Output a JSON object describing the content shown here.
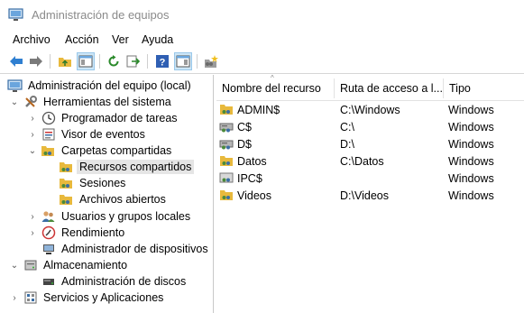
{
  "window": {
    "title": "Administración de equipos"
  },
  "menu": [
    "Archivo",
    "Acción",
    "Ver",
    "Ayuda"
  ],
  "toolbar": {
    "buttons": [
      "back-icon",
      "forward-icon",
      "up-folder-icon",
      "show-hide-tree-icon",
      "refresh-icon",
      "export-list-icon",
      "help-icon",
      "show-action-pane-icon",
      "new-share-icon"
    ]
  },
  "tree": {
    "root": "Administración del equipo (local)",
    "system_tools": "Herramientas del sistema",
    "task_scheduler": "Programador de tareas",
    "event_viewer": "Visor de eventos",
    "shared_folders": "Carpetas compartidas",
    "shares": "Recursos compartidos",
    "sessions": "Sesiones",
    "open_files": "Archivos abiertos",
    "local_users": "Usuarios y grupos locales",
    "performance": "Rendimiento",
    "device_manager": "Administrador de dispositivos",
    "storage": "Almacenamiento",
    "disk_management": "Administración de discos",
    "services": "Servicios y Aplicaciones"
  },
  "list": {
    "columns": [
      "Nombre del recurso",
      "Ruta de acceso a l...",
      "Tipo"
    ],
    "rows": [
      {
        "name": "ADMIN$",
        "path": "C:\\Windows",
        "type": "Windows",
        "icon": "share-icon"
      },
      {
        "name": "C$",
        "path": "C:\\",
        "type": "Windows",
        "icon": "drive-share-icon"
      },
      {
        "name": "D$",
        "path": "D:\\",
        "type": "Windows",
        "icon": "drive-share-icon"
      },
      {
        "name": "Datos",
        "path": "C:\\Datos",
        "type": "Windows",
        "icon": "share-icon"
      },
      {
        "name": "IPC$",
        "path": "",
        "type": "Windows",
        "icon": "ipc-share-icon"
      },
      {
        "name": "Videos",
        "path": "D:\\Videos",
        "type": "Windows",
        "icon": "share-icon"
      }
    ]
  },
  "colors": {
    "selection": "#e5e5e5",
    "pressed": "#cde6f7",
    "title_text": "#8a8a8a",
    "folder": "#e8b93c",
    "arrow": "#2f7fd1"
  }
}
